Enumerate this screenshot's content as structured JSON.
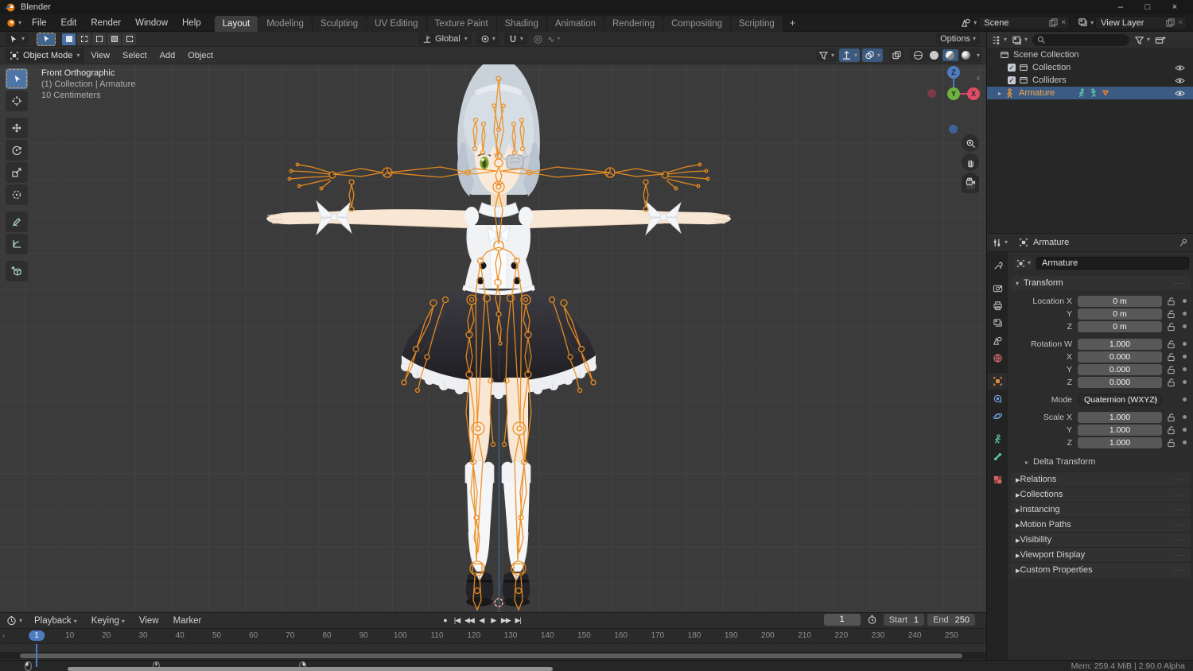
{
  "colors": {
    "accent_blue": "#4772b3",
    "bone_orange": "#ee8e1e",
    "selection_row": "#3b5b84",
    "active_object_text": "#f5a84b",
    "viewport_bg": "#3b3b3b"
  },
  "window": {
    "title": "Blender",
    "minimize": "–",
    "maximize": "□",
    "close": "×"
  },
  "topbar": {
    "menus": [
      "File",
      "Edit",
      "Render",
      "Window",
      "Help"
    ],
    "workspaces": [
      {
        "label": "Layout",
        "active": true
      },
      {
        "label": "Modeling"
      },
      {
        "label": "Sculpting"
      },
      {
        "label": "UV Editing"
      },
      {
        "label": "Texture Paint"
      },
      {
        "label": "Shading"
      },
      {
        "label": "Animation"
      },
      {
        "label": "Rendering"
      },
      {
        "label": "Compositing"
      },
      {
        "label": "Scripting"
      }
    ],
    "add_workspace": "+",
    "scene_label": "Scene",
    "view_layer_label": "View Layer"
  },
  "tool_header": {
    "orientation": "Global",
    "options": "Options"
  },
  "viewport": {
    "mode": "Object Mode",
    "menus": [
      "View",
      "Select",
      "Add",
      "Object"
    ],
    "overlay": [
      "Front Orthographic",
      "(1) Collection | Armature",
      "10 Centimeters"
    ],
    "gizmo": {
      "z": "Z",
      "y": "Y",
      "x": "X"
    }
  },
  "outliner": {
    "root": "Scene Collection",
    "items": [
      {
        "label": "Collection"
      },
      {
        "label": "Colliders"
      }
    ],
    "active_item": "Armature"
  },
  "properties": {
    "breadcrumb": "Armature",
    "name": "Armature",
    "transform": {
      "title": "Transform",
      "rows": [
        {
          "label": "Location X",
          "value": "0 m"
        },
        {
          "label": "Y",
          "value": "0 m"
        },
        {
          "label": "Z",
          "value": "0 m"
        },
        {
          "label": "Rotation W",
          "value": "1.000",
          "group_start": true
        },
        {
          "label": "X",
          "value": "0.000"
        },
        {
          "label": "Y",
          "value": "0.000"
        },
        {
          "label": "Z",
          "value": "0.000"
        },
        {
          "label": "Mode",
          "value": "Quaternion (WXYZ)",
          "type": "dropdown",
          "group_start": true
        },
        {
          "label": "Scale X",
          "value": "1.000",
          "group_start": true
        },
        {
          "label": "Y",
          "value": "1.000"
        },
        {
          "label": "Z",
          "value": "1.000"
        }
      ],
      "subpanel": "Delta Transform"
    },
    "panels": [
      "Relations",
      "Collections",
      "Instancing",
      "Motion Paths",
      "Visibility",
      "Viewport Display",
      "Custom Properties"
    ]
  },
  "timeline": {
    "menus": [
      "Playback",
      "Keying",
      "View",
      "Marker"
    ],
    "transport": [
      {
        "name": "record",
        "glyph": "●"
      },
      {
        "name": "jump-to-start",
        "glyph": "|◀"
      },
      {
        "name": "previous-keyframe",
        "glyph": "◀◀"
      },
      {
        "name": "previous-frame",
        "glyph": "◀"
      },
      {
        "name": "play",
        "glyph": "▶"
      },
      {
        "name": "next-keyframe",
        "glyph": "▶▶"
      },
      {
        "name": "jump-to-end",
        "glyph": "▶|"
      }
    ],
    "current_frame": "1",
    "frame_badge": "1",
    "start_label": "Start",
    "start_value": "1",
    "end_label": "End",
    "end_value": "250",
    "ticks": [
      10,
      20,
      30,
      40,
      50,
      60,
      70,
      80,
      90,
      100,
      110,
      120,
      130,
      140,
      150,
      160,
      170,
      180,
      190,
      200,
      210,
      220,
      230,
      240,
      250
    ]
  },
  "status": {
    "memory": "Mem: 259.4 MiB | 2.90.0 Alpha"
  },
  "icons": {
    "caret": "▾",
    "collapsed_arrow": "▸",
    "expanded_arrow": "▾",
    "check": "✓",
    "proportional": "◎",
    "falloff": "∿",
    "sidebar_chevron": "‹",
    "channel_arrow": "›",
    "drag_dots": "····"
  }
}
